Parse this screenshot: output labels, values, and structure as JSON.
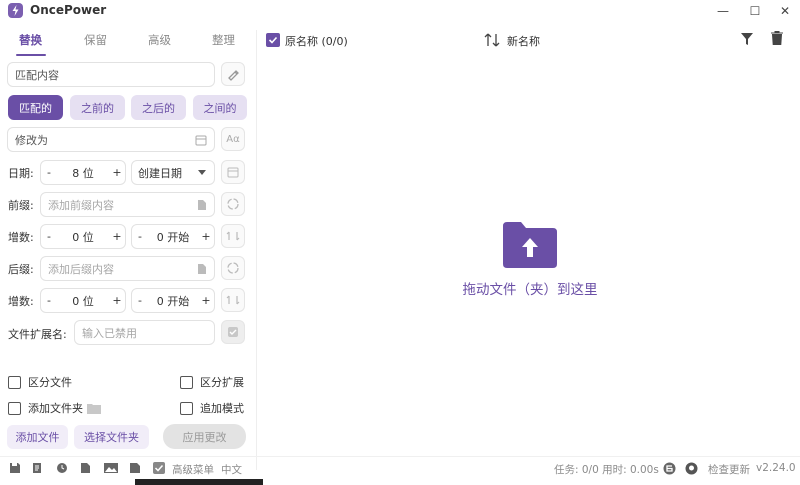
{
  "app": {
    "title": "OncePower"
  },
  "window": {
    "minimize": "—",
    "maximize": "☐",
    "close": "✕"
  },
  "tabs": [
    {
      "label": "替换",
      "active": true
    },
    {
      "label": "保留",
      "active": false
    },
    {
      "label": "高级",
      "active": false
    },
    {
      "label": "整理",
      "active": false
    }
  ],
  "replace": {
    "match_placeholder": "匹配内容",
    "position_options": [
      "匹配的",
      "之前的",
      "之后的",
      "之间的"
    ],
    "selected_position": "匹配的",
    "modify_placeholder": "修改为",
    "case_icon_text": "Aα"
  },
  "date": {
    "label": "日期:",
    "digits": "8 位",
    "type": "创建日期"
  },
  "prefix": {
    "label": "前缀:",
    "placeholder": "添加前缀内容"
  },
  "increment1": {
    "label": "增数:",
    "digits": "0 位",
    "start": "0 开始"
  },
  "suffix": {
    "label": "后缀:",
    "placeholder": "添加后缀内容"
  },
  "increment2": {
    "label": "增数:",
    "digits": "0 位",
    "start": "0 开始"
  },
  "extension": {
    "label": "文件扩展名:",
    "placeholder": "输入已禁用"
  },
  "options": {
    "distinguish_files": "区分文件",
    "distinguish_ext": "区分扩展",
    "add_folder": "添加文件夹",
    "append_mode": "追加模式"
  },
  "buttons": {
    "add_file": "添加文件",
    "select_folder": "选择文件夹",
    "apply": "应用更改"
  },
  "list_header": {
    "original": "原名称 (0/0)",
    "new_name": "新名称"
  },
  "dropzone": {
    "text": "拖动文件（夹）到这里"
  },
  "status": {
    "advanced_menu": "高级菜单",
    "language": "中文",
    "tasks": "任务: 0/0 用时: 0.00s",
    "check_update": "检查更新",
    "version": "v2.24.0"
  },
  "colors": {
    "accent": "#6a4fa6",
    "chip": "#e6e0f2"
  }
}
